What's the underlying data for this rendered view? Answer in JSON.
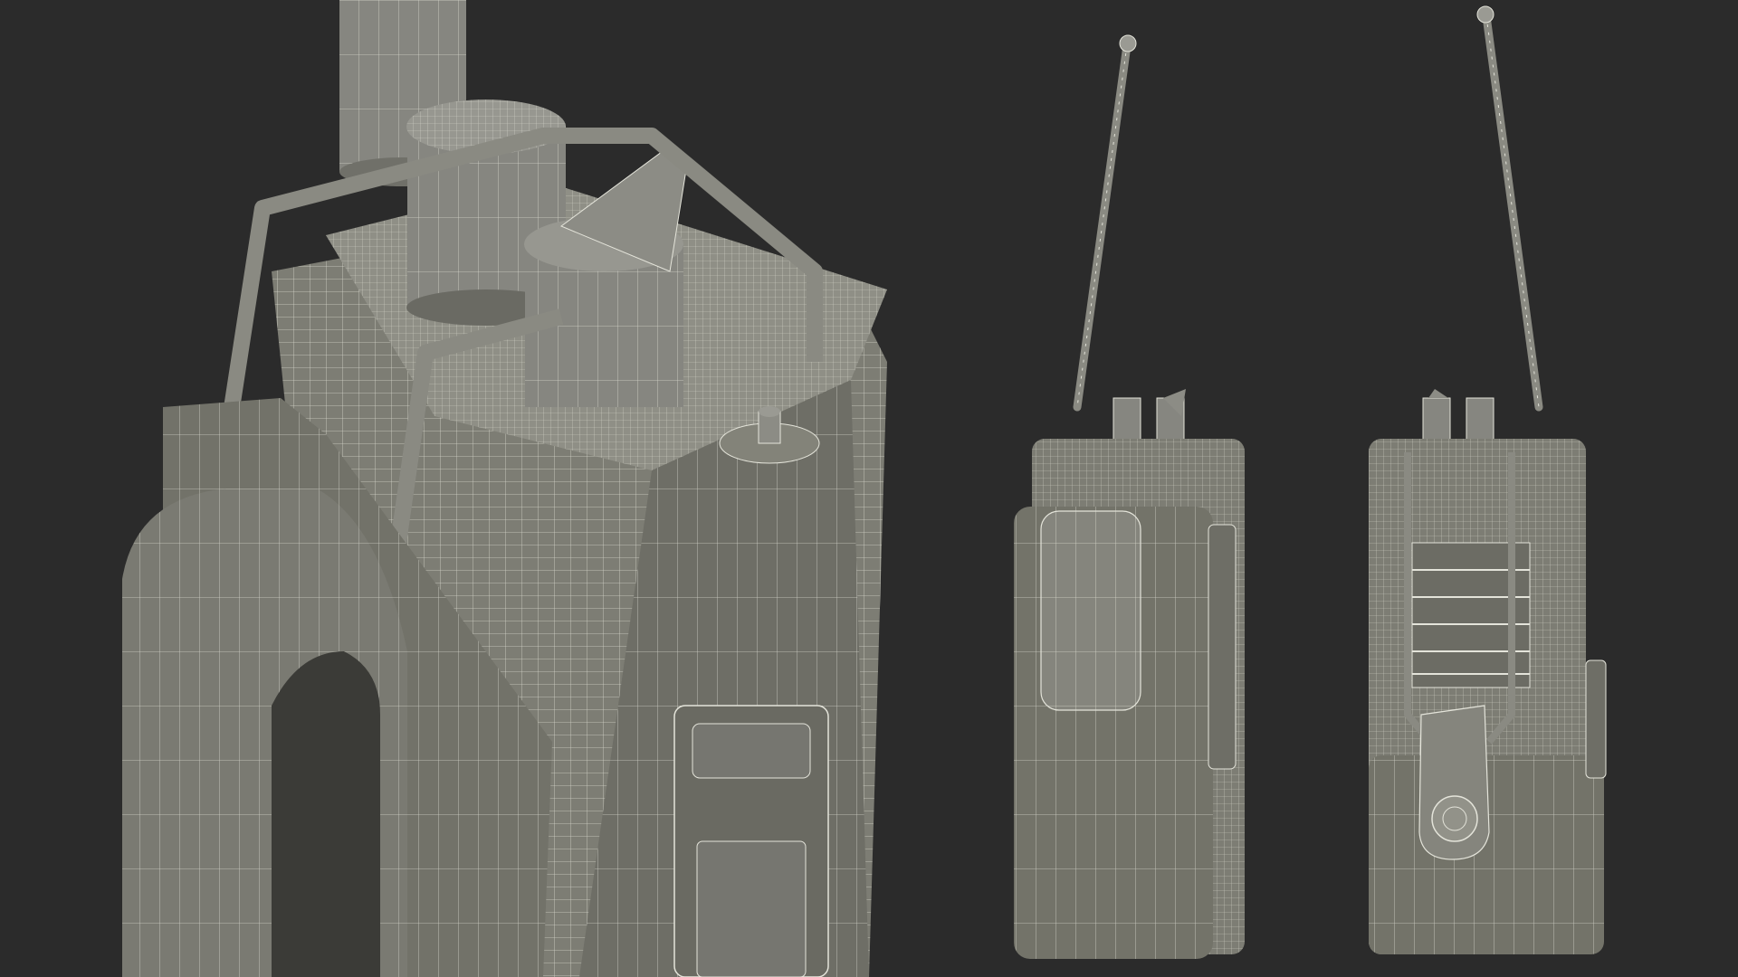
{
  "scene": {
    "subject": "radio-with-holster-wireframe-render",
    "views": [
      {
        "id": "closeup",
        "description_icon": "radio-closeup-icon"
      },
      {
        "id": "front",
        "description_icon": "radio-front-icon"
      },
      {
        "id": "back",
        "description_icon": "radio-back-icon"
      }
    ],
    "colors": {
      "background": "#2b2b2b",
      "surface": "#7d7d74",
      "surface_light": "#8f8f86",
      "surface_dark": "#5f5f58",
      "wire": "#e4e4da",
      "shadow": "#3a3a36"
    }
  }
}
